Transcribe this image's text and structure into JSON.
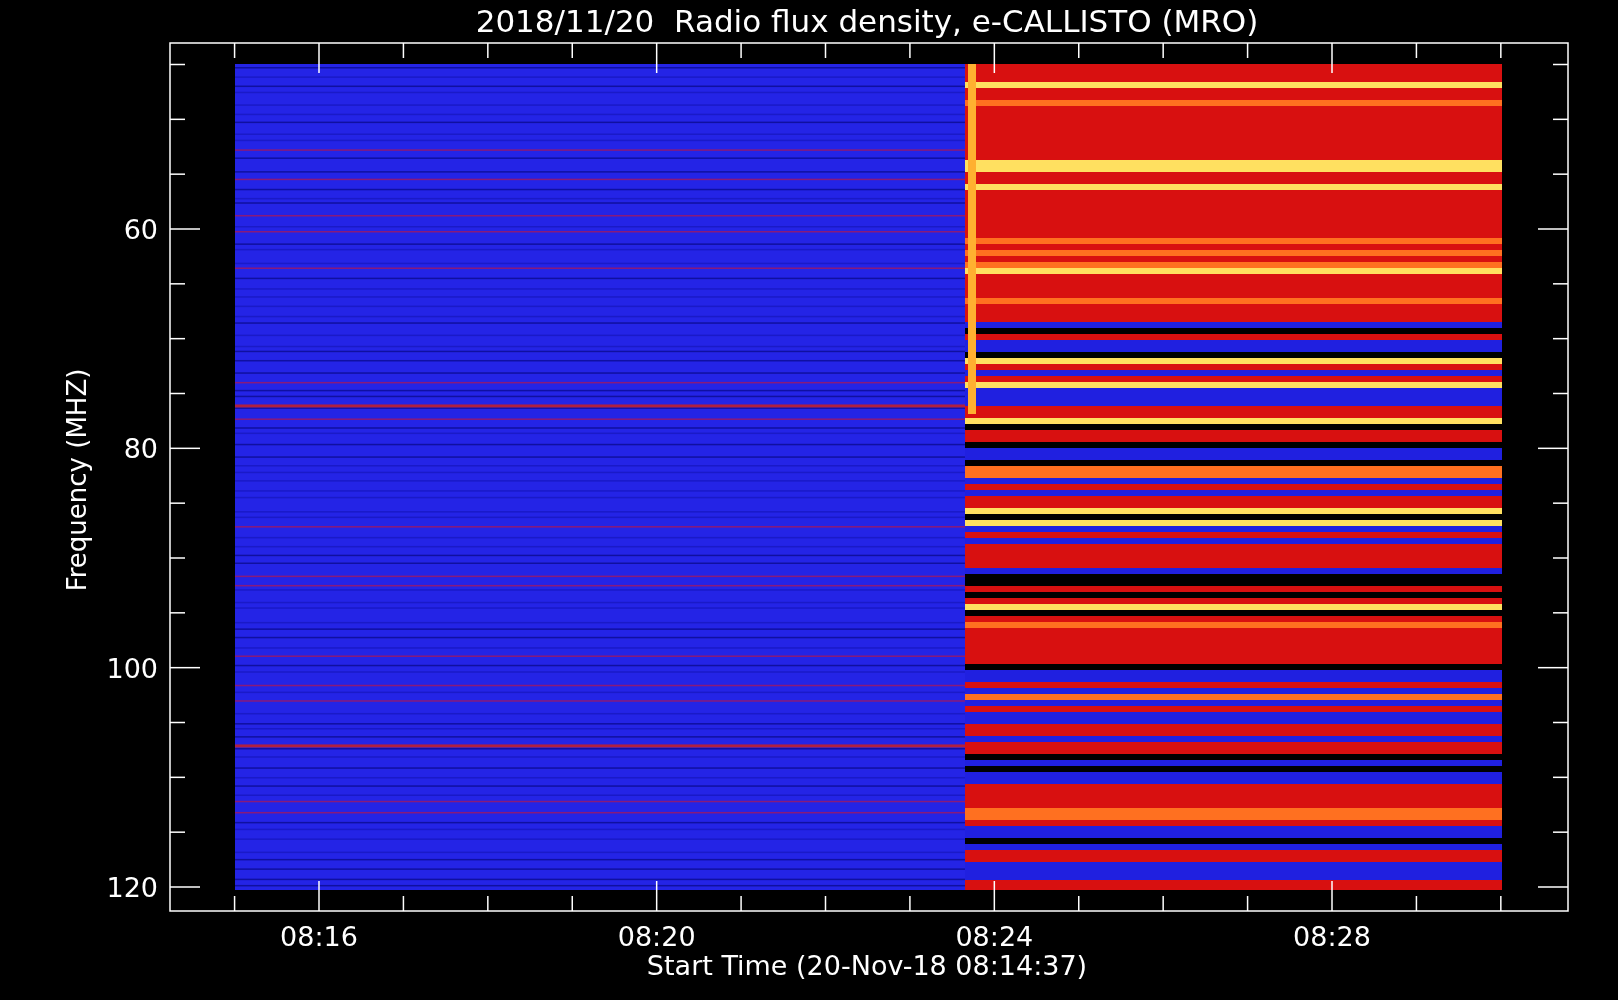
{
  "title": "2018/11/20  Radio flux density, e-CALLISTO (MRO)",
  "chart": {
    "ylabel": "Frequency (MHZ)",
    "xlabel": "Start Time (20-Nov-18 08:14:37)",
    "yticks": [
      "60",
      "80",
      "100",
      "120"
    ],
    "xticks": [
      "08:16",
      "08:20",
      "08:24",
      "08:28"
    ]
  }
}
